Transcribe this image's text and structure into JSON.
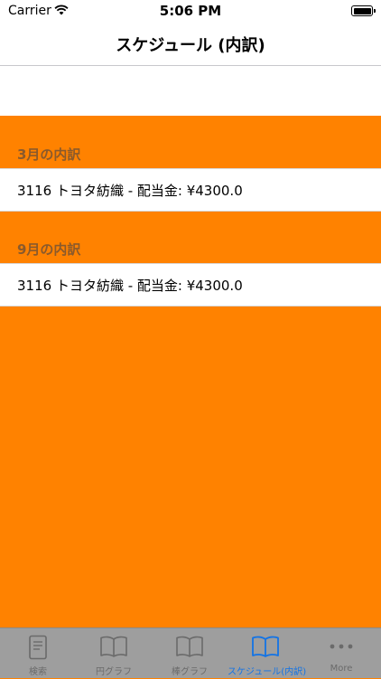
{
  "status_bar": {
    "carrier": "Carrier",
    "time": "5:06 PM"
  },
  "nav": {
    "title": "スケジュール (内訳)"
  },
  "sections": [
    {
      "header": "3月の内訳",
      "rows": [
        {
          "text": "3116 トヨタ紡織 - 配当金: ¥4300.0"
        }
      ]
    },
    {
      "header": "9月の内訳",
      "rows": [
        {
          "text": "3116 トヨタ紡織 - 配当金: ¥4300.0"
        }
      ]
    }
  ],
  "tabs": [
    {
      "label": "検索",
      "icon": "document-icon"
    },
    {
      "label": "円グラフ",
      "icon": "book-icon"
    },
    {
      "label": "棒グラフ",
      "icon": "book-icon"
    },
    {
      "label": "スケジュール(内訳)",
      "icon": "book-icon",
      "active": true
    },
    {
      "label": "More",
      "icon": "more-icon"
    }
  ],
  "colors": {
    "background": "#ff8200",
    "active_tab": "#1273e6",
    "inactive_tab": "#6a6a6a",
    "tab_bar": "#9e9e9e"
  }
}
